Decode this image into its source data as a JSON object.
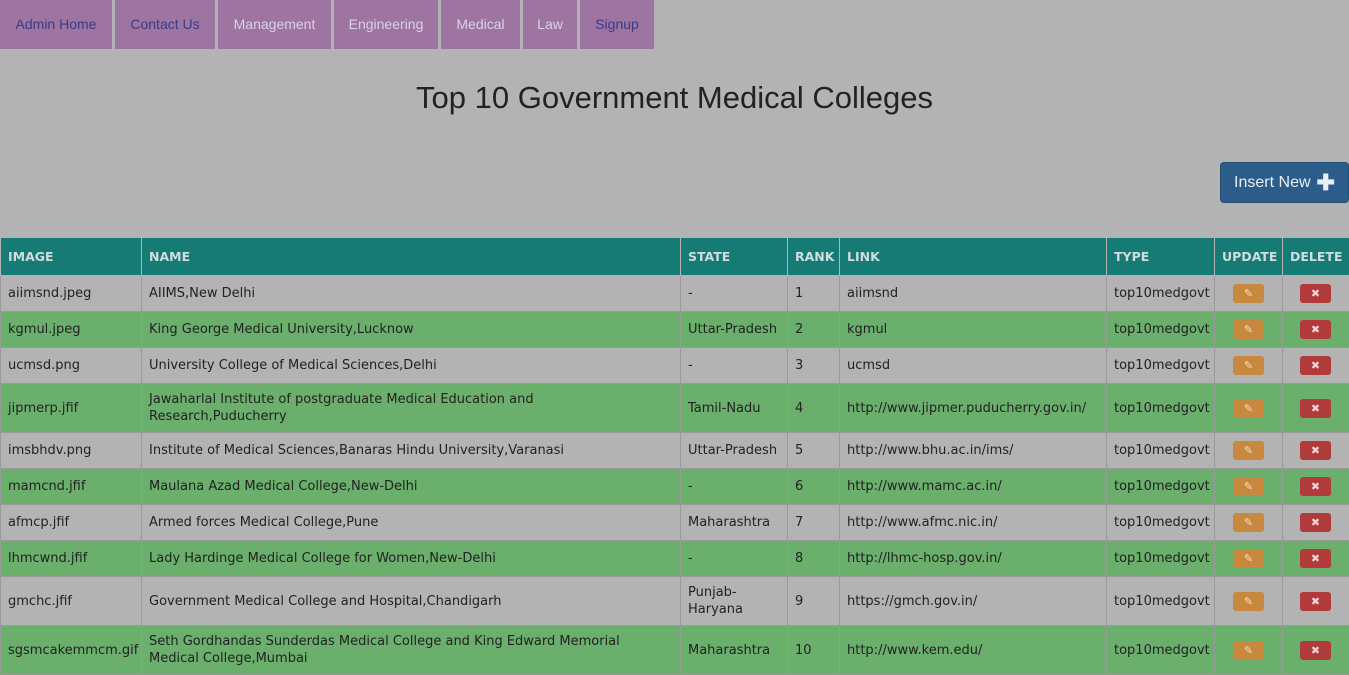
{
  "nav": [
    {
      "label": "Admin Home"
    },
    {
      "label": "Contact Us"
    },
    {
      "label": "Management"
    },
    {
      "label": "Engineering"
    },
    {
      "label": "Medical"
    },
    {
      "label": "Law"
    },
    {
      "label": "Signup"
    }
  ],
  "page_title": "Top 10 Government Medical Colleges",
  "insert_button": {
    "label": "Insert New",
    "icon": "plus-icon"
  },
  "table": {
    "headers": [
      "IMAGE",
      "NAME",
      "STATE",
      "RANK",
      "LINK",
      "TYPE",
      "UPDATE",
      "DELETE"
    ],
    "rows": [
      {
        "image": "aiimsnd.jpeg",
        "name": "AIIMS,New Delhi",
        "state": "-",
        "rank": "1",
        "link": "aiimsnd",
        "type": "top10medgovt"
      },
      {
        "image": "kgmul.jpeg",
        "name": "King George Medical University,Lucknow",
        "state": "Uttar-Pradesh",
        "rank": "2",
        "link": "kgmul",
        "type": "top10medgovt"
      },
      {
        "image": "ucmsd.png",
        "name": "University College of Medical Sciences,Delhi",
        "state": "-",
        "rank": "3",
        "link": "ucmsd",
        "type": "top10medgovt"
      },
      {
        "image": "jipmerp.jfif",
        "name": "Jawaharlal Institute of postgraduate Medical Education and Research,Puducherry",
        "state": "Tamil-Nadu",
        "rank": "4",
        "link": "http://www.jipmer.puducherry.gov.in/",
        "type": "top10medgovt"
      },
      {
        "image": "imsbhdv.png",
        "name": "Institute of Medical Sciences,Banaras Hindu University,Varanasi",
        "state": "Uttar-Pradesh",
        "rank": "5",
        "link": "http://www.bhu.ac.in/ims/",
        "type": "top10medgovt"
      },
      {
        "image": "mamcnd.jfif",
        "name": "Maulana Azad Medical College,New-Delhi",
        "state": "-",
        "rank": "6",
        "link": "http://www.mamc.ac.in/",
        "type": "top10medgovt"
      },
      {
        "image": "afmcp.jfif",
        "name": "Armed forces Medical College,Pune",
        "state": "Maharashtra",
        "rank": "7",
        "link": "http://www.afmc.nic.in/",
        "type": "top10medgovt"
      },
      {
        "image": "lhmcwnd.jfif",
        "name": "Lady Hardinge Medical College for Women,New-Delhi",
        "state": "-",
        "rank": "8",
        "link": "http://lhmc-hosp.gov.in/",
        "type": "top10medgovt"
      },
      {
        "image": "gmchc.jfif",
        "name": "Government Medical College and Hospital,Chandigarh",
        "state": "Punjab-Haryana",
        "rank": "9",
        "link": "https://gmch.gov.in/",
        "type": "top10medgovt"
      },
      {
        "image": "sgsmcakemmcm.gif",
        "name": "Seth Gordhandas Sunderdas Medical College and King Edward Memorial Medical College,Mumbai",
        "state": "Maharashtra",
        "rank": "10",
        "link": "http://www.kem.edu/",
        "type": "top10medgovt"
      }
    ]
  },
  "icons": {
    "update": "pencil-icon",
    "delete": "close-icon"
  },
  "colors": {
    "nav_bg": "#9e74a0",
    "header_bg": "#167a75",
    "row_alt": "#6aaf6c",
    "insert_btn": "#2b5c8a",
    "update_btn": "#c8893f",
    "delete_btn": "#b13a3a"
  }
}
